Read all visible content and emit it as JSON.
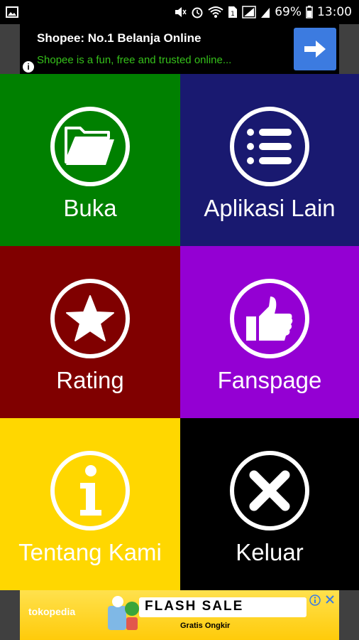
{
  "status_bar": {
    "battery": "69%",
    "time": "13:00",
    "icons": [
      "image-icon",
      "mute-icon",
      "alarm-icon",
      "wifi-icon",
      "sim-icon",
      "signal-icon",
      "battery-icon"
    ]
  },
  "ad_top": {
    "title": "Shopee: No.1 Belanja Online",
    "description": "Shopee is a fun, free and trusted online...",
    "info_label": "i"
  },
  "menu": [
    {
      "label": "Buka",
      "icon": "folder-icon",
      "color": "#008000"
    },
    {
      "label": "Aplikasi Lain",
      "icon": "list-icon",
      "color": "#191970"
    },
    {
      "label": "Rating",
      "icon": "star-icon",
      "color": "#800000"
    },
    {
      "label": "Fanspage",
      "icon": "thumbs-up-icon",
      "color": "#9400D3"
    },
    {
      "label": "Tentang Kami",
      "icon": "info-icon",
      "color": "#FFD700"
    },
    {
      "label": "Keluar",
      "icon": "close-icon",
      "color": "#000000"
    }
  ],
  "ad_bottom": {
    "brand": "tokopedia",
    "headline": "FLASH SALE",
    "subline": "Gratis Ongkir"
  }
}
